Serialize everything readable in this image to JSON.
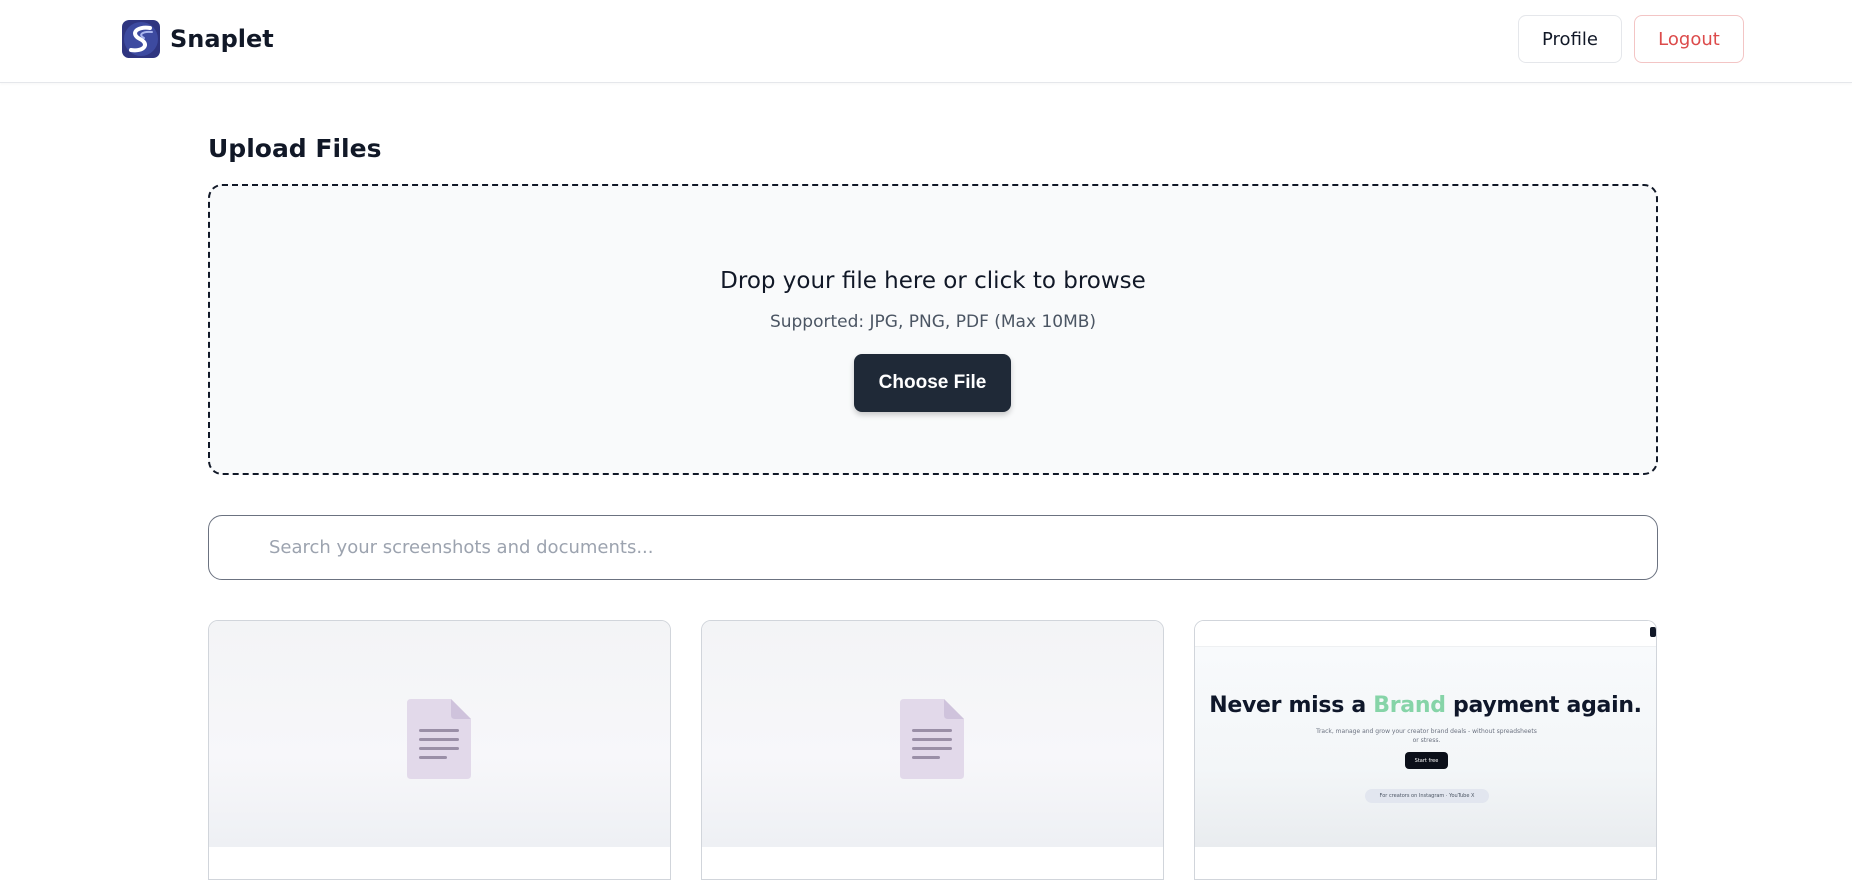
{
  "header": {
    "app_name": "Snaplet",
    "profile_label": "Profile",
    "logout_label": "Logout"
  },
  "upload": {
    "title": "Upload Files",
    "drop_title": "Drop your file here or click to browse",
    "supported": "Supported: JPG, PNG, PDF (Max 10MB)",
    "choose_label": "Choose File"
  },
  "search": {
    "value": "",
    "placeholder": "Search your screenshots and documents..."
  },
  "files": [
    {
      "type": "document",
      "icon": "document-icon"
    },
    {
      "type": "document",
      "icon": "document-icon"
    },
    {
      "type": "screenshot",
      "headline_before": "Never miss a ",
      "headline_accent": "Brand",
      "headline_after": " payment again.",
      "sub": "Track, manage and grow your creator brand deals - without spreadsheets or stress.",
      "cta": "Start free",
      "chip": "For creators on Instagram · YouTube   X"
    }
  ],
  "colors": {
    "primary_dark": "#1f2937",
    "logout_red": "#dc4b4b",
    "accent_green": "#86d4a8",
    "logo_blue": "#3b3f8f"
  }
}
